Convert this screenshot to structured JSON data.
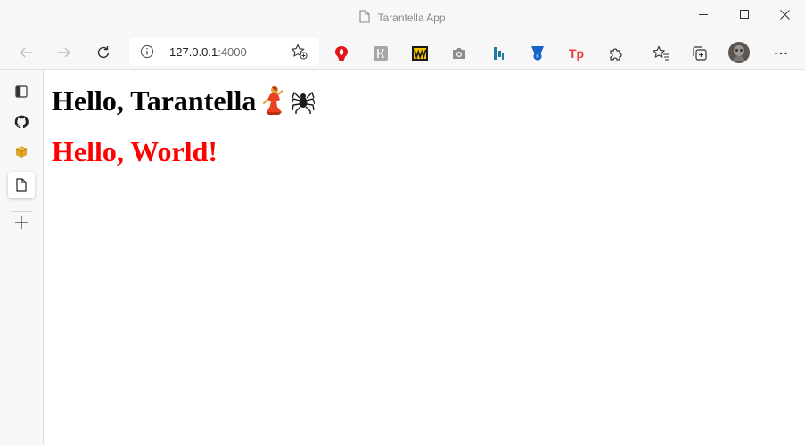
{
  "window": {
    "title": "Tarantella App",
    "controls": [
      "minimize",
      "maximize",
      "close"
    ]
  },
  "toolbar": {
    "nav": [
      "back",
      "forward",
      "refresh"
    ],
    "address": {
      "host": "127.0.0.1",
      "port": ":4000"
    },
    "extensions": [
      "opera-red-icon",
      "tampermonkey-grey-icon",
      "w-yellow-icon",
      "camera-icon",
      "bars-blue-icon",
      "medal-blue-icon",
      "tp-red-icon",
      "puzzle-icon"
    ],
    "right_buttons": [
      "favorites",
      "collections",
      "profile",
      "more"
    ]
  },
  "sidebar": {
    "items": [
      "tab-actions",
      "github",
      "package",
      "page",
      "add"
    ]
  },
  "page": {
    "heading": "Hello, Tarantella",
    "subheading": "Hello, World!",
    "subheading_color": "#ff0000"
  }
}
